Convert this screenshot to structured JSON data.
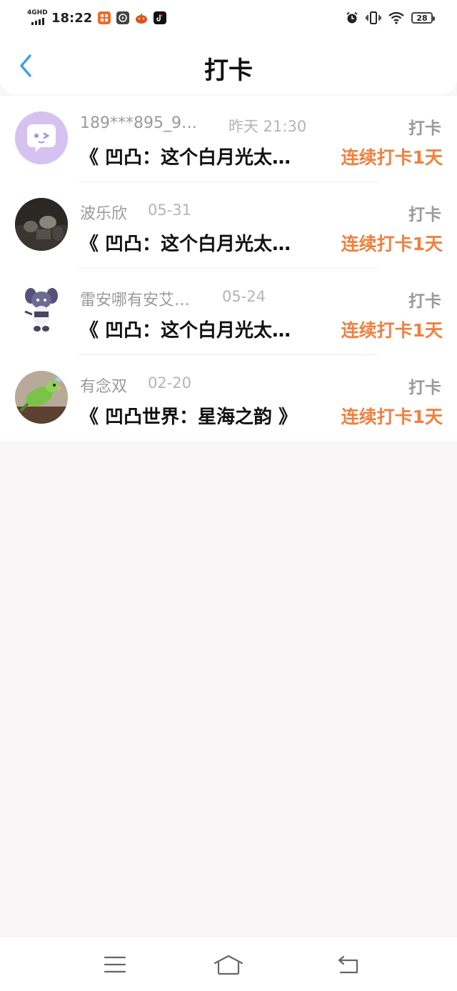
{
  "status_bar": {
    "network": "4GHD",
    "time": "18:22",
    "battery": "28",
    "icons": [
      "app-store-icon",
      "video-player-icon",
      "pumpkin-app-icon",
      "tiktok-icon",
      "alarm-icon",
      "vibrate-icon",
      "wifi-icon",
      "battery-icon"
    ]
  },
  "header": {
    "title": "打卡",
    "back_icon": "chevron-left-icon"
  },
  "checkins": [
    {
      "name": "189***895_9…",
      "date": "昨天 21:30",
      "tag": "打卡",
      "book": "《 凹凸：这个白月光太…",
      "streak": "连续打卡1天",
      "avatar": "chat-bubble-avatar"
    },
    {
      "name": "波乐欣",
      "date": "05-31",
      "tag": "打卡",
      "book": "《 凹凸：这个白月光太…",
      "streak": "连续打卡1天",
      "avatar": "photo-avatar"
    },
    {
      "name": "雷安哪有安艾…",
      "date": "05-24",
      "tag": "打卡",
      "book": "《 凹凸：这个白月光太…",
      "streak": "连续打卡1天",
      "avatar": "bunny-avatar"
    },
    {
      "name": "有念双",
      "date": "02-20",
      "tag": "打卡",
      "book": "《 凹凸世界：星海之韵 》",
      "streak": "连续打卡1天",
      "avatar": "parrot-avatar"
    }
  ],
  "system_nav": {
    "icons": [
      "menu-icon",
      "home-icon",
      "back-icon"
    ]
  },
  "colors": {
    "accent_blue": "#3aa0e8",
    "streak_orange": "#f08040",
    "page_bg": "#f8f6f7"
  }
}
